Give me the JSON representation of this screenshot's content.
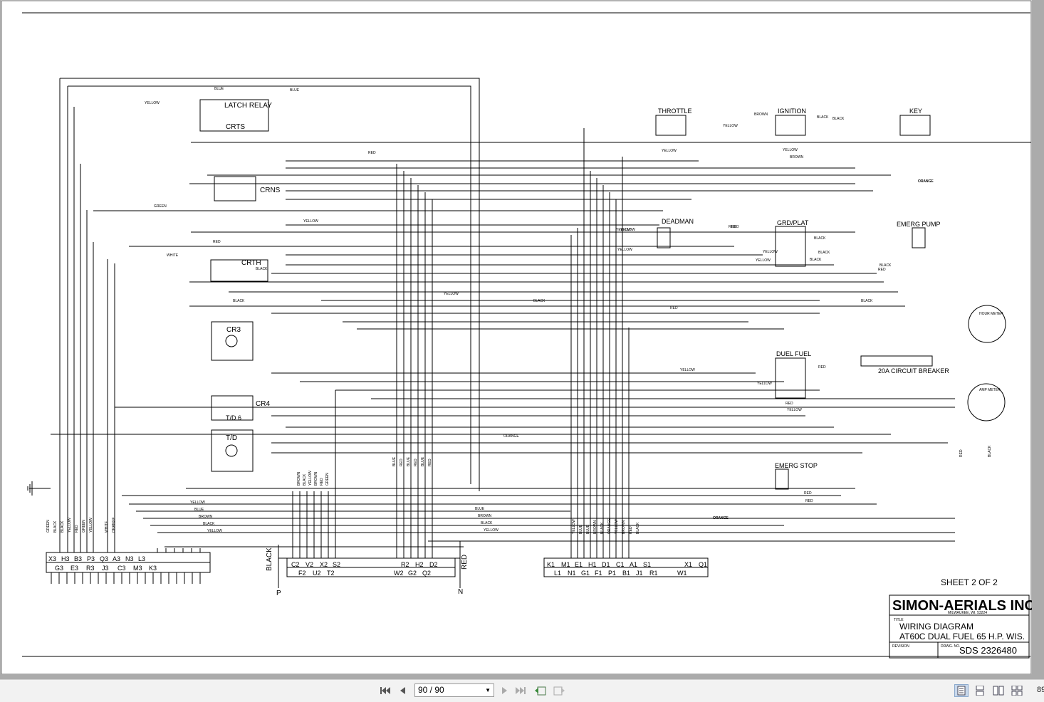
{
  "document": {
    "title_block": {
      "company": "SIMON-AERIALS INC.",
      "address": "MILWAUKEE, WI. 53224",
      "title_label": "TITLE",
      "title_line1": "WIRING DIAGRAM",
      "title_line2": "AT60C DUAL FUEL 65 H.P. WIS.",
      "revision_label": "REVISION",
      "drawing_no_label": "DRWG. NO.",
      "drawing_no": "SDS 2326480"
    },
    "sheet": "SHEET 2 OF 2",
    "components": {
      "latch_relay": "LATCH RELAY",
      "crts": "CRTS",
      "crns": "CRNS",
      "crth": "CRTH",
      "cr3": "CR3",
      "cr4": "CR4",
      "td": "T/D",
      "td6": "T/D 6",
      "throttle": "THROTTLE",
      "ignition": "IGNITION",
      "key": "KEY",
      "deadman": "DEADMAN",
      "grd_plat": "GRD/PLAT",
      "emerg_pump": "EMERG PUMP",
      "dual_fuel": "DUEL FUEL",
      "emerg_stop": "EMERG STOP",
      "hour_meter": "HOUR METER",
      "amp_meter": "AMP METER",
      "circuit_breaker": "20A CIRCUIT BREAKER"
    },
    "connectors": {
      "left_top": [
        "X3",
        "H3",
        "B3",
        "P3",
        "Q3",
        "A3",
        "N3",
        "L3"
      ],
      "left_bottom": [
        "G3",
        "E3",
        "R3",
        "J3",
        "C3",
        "M3",
        "K3"
      ],
      "middle_top": [
        "C2",
        "V2",
        "X2",
        "S2",
        "R2",
        "H2",
        "D2"
      ],
      "middle_bottom": [
        "F2",
        "U2",
        "T2",
        "W2",
        "G2",
        "Q2"
      ],
      "middle_left_wire": "BLACK",
      "middle_right_wire": "RED",
      "middle_left_pin": "P",
      "middle_right_pin": "N",
      "right_top": [
        "K1",
        "M1",
        "E1",
        "H1",
        "D1",
        "C1",
        "A1",
        "S1",
        "X1",
        "Q1"
      ],
      "right_bottom": [
        "L1",
        "N1",
        "G1",
        "F1",
        "P1",
        "B1",
        "J1",
        "R1",
        "W1"
      ]
    },
    "wire_colors": {
      "left_vertical": [
        "GREEN",
        "BLACK",
        "BLACK",
        "YELLOW",
        "RED",
        "GREEN",
        "YELLOW",
        "WHITE",
        "ORANGE"
      ],
      "mid_vertical": [
        "BROWN",
        "BLACK",
        "YELLOW",
        "BROWN",
        "RED",
        "GREEN"
      ],
      "center_vertical": [
        "BLUE",
        "RED",
        "BLUE",
        "RED",
        "BLUE",
        "RED"
      ],
      "right_vertical": [
        "YELLOW",
        "BLUE",
        "BLUE",
        "BROWN",
        "BLACK",
        "ORANGE",
        "YELLOW",
        "BROWN",
        "RED",
        "BLACK"
      ],
      "left_bus": [
        "YELLOW",
        "BLUE",
        "BROWN",
        "BLACK",
        "YELLOW"
      ],
      "center_bus": [
        "BLUE",
        "BROWN",
        "BLACK",
        "YELLOW"
      ],
      "horizontal_labels": [
        "BLUE",
        "BLUE",
        "YELLOW",
        "RED",
        "GREEN",
        "YELLOW",
        "RED",
        "WHITE",
        "BLACK",
        "YELLOW",
        "BLACK",
        "BLACK",
        "RED",
        "BLACK",
        "YELLOW",
        "ORANGE",
        "ORANGE",
        "ORANGE",
        "YELLOW",
        "YELLOW",
        "BROWN",
        "BLACK",
        "RED",
        "RED",
        "RED",
        "BLACK",
        "YELLOW",
        "YELLOW",
        "BROWN",
        "BLACK",
        "YELLOW",
        "RED",
        "BLACK",
        "YELLOW",
        "YELLOW",
        "YELLOW",
        "RED",
        "RED",
        "RED",
        "BLACK",
        "YELLOW",
        "YELLOW",
        "BLACK",
        "ORANGE",
        "ORANGE",
        "RED",
        "BLACK"
      ]
    }
  },
  "toolbar": {
    "page_indicator": "90 / 90",
    "zoom": "89"
  },
  "colors": {
    "viewer_bg": "#ababab",
    "page_bg": "#ffffff",
    "ink": "#000000",
    "toolbar_bg": "#f2f2f2",
    "active_view": "#c8d8ec"
  }
}
